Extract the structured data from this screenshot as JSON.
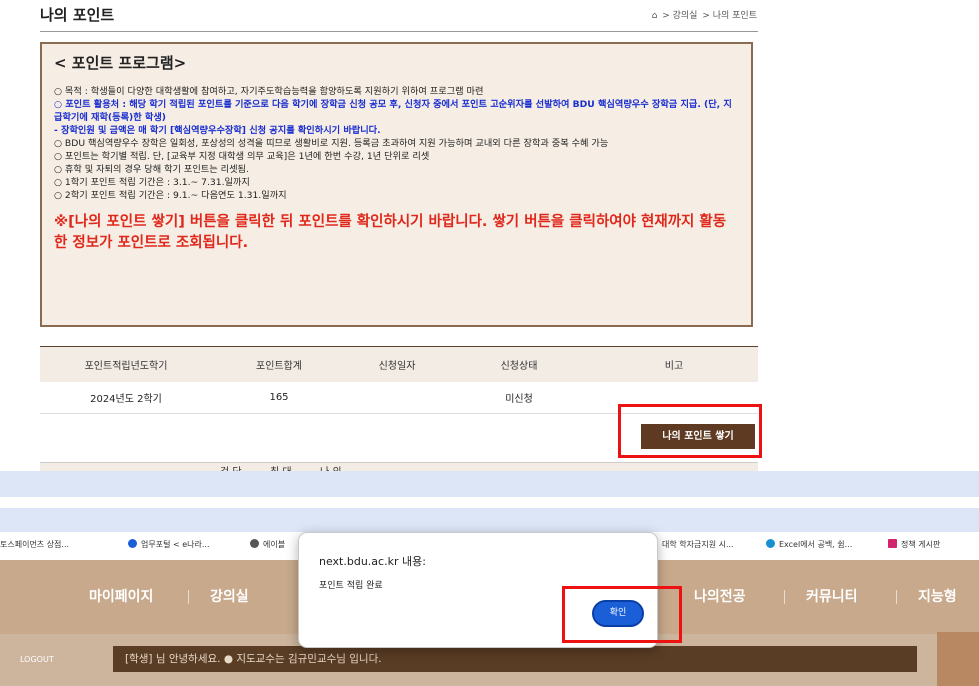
{
  "page": {
    "title": "나의 포인트",
    "breadcrumb": [
      "⌂",
      "> 강의실",
      "> 나의 포인트"
    ]
  },
  "intro": {
    "heading": "< 포인트 프로그램>",
    "lines": [
      "○ 목적 : 학생들이 다양한 대학생활에 참여하고, 자기주도학습능력을 함양하도록 지원하기 위하여 프로그램 마련",
      "○ 포인트 활용처 : 해당 학기 적립된 포인트를 기준으로 다음 학기에 장학금 신청 공모 후, 신청자 중에서 포인트 고순위자를 선발하여 BDU 핵심역량우수 장학금 지급. (단, 지급학기에 재학(등록)한 학생)",
      "- 장학인원 및 금액은 매 학기 [핵심역량우수장학] 신청 공지를 확인하시기 바랍니다.",
      "○ BDU 핵심역량우수 장학은 일회성, 포상성의 성격을 띠므로 생활비로 지원. 등록금 초과하여 지원 가능하며 교내외 다른 장학과 중복 수혜 가능",
      "○ 포인트는 학기별 적립. 단, [교육부 지정 대학생 의무 교육]은 1년에 한번 수강, 1년 단위로 리셋",
      "○ 휴학 및 자퇴의 경우 당해 학기 포인트는 리셋됨.",
      "○ 1학기 포인트 적립 기간은 : 3.1.~ 7.31.일까지",
      "○ 2학기 포인트 적립 기간은 : 9.1.~ 다음연도 1.31.일까지"
    ],
    "notice": "※[나의 포인트 쌓기] 버튼을 클릭한 뒤 포인트를 확인하시기 바랍니다. 쌓기 버튼을 클릭하여야 현재까지 활동한 정보가 포인트로 조회됩니다."
  },
  "table": {
    "headers": [
      "포인트적립년도학기",
      "포인트합계",
      "신청일자",
      "신청상태",
      "비고"
    ],
    "rows": [
      [
        "2024년도 2학기",
        "165",
        "",
        "미신청",
        ""
      ]
    ]
  },
  "gather_button": "나의 포인트 쌓기",
  "faded_row_text": [
    "검 단",
    "최 대",
    "나 의"
  ],
  "bookmarks": [
    {
      "label": "토스페이먼츠 상점...",
      "icon": "none"
    },
    {
      "label": "업무포털 < e나라...",
      "icon": "nara-icon"
    },
    {
      "label": "에이블",
      "icon": "globe-icon"
    },
    {
      "label": "대학 학자금지원 시...",
      "icon": "none"
    },
    {
      "label": "Excel에서 공백, 쉼...",
      "icon": "excel-icon"
    },
    {
      "label": "정책 게시판",
      "icon": "policy-icon"
    }
  ],
  "nav": [
    "마이페이지",
    "강의실",
    "나의전공",
    "커뮤니티",
    "지능형"
  ],
  "logout": "LOGOUT",
  "welcome": "[학생] 님 안녕하세요. ● 지도교수는 김규민교수님 입니다.",
  "dialog": {
    "title": "next.bdu.ac.kr 내용:",
    "message": "포인트 적립 완료",
    "ok": "확인"
  },
  "colors": {
    "accent_brown": "#5e3a22",
    "highlight_red": "#ee1111",
    "ok_blue": "#1a5ed8",
    "notice_red": "#e0271b",
    "blue_text": "#1a2ed0"
  }
}
